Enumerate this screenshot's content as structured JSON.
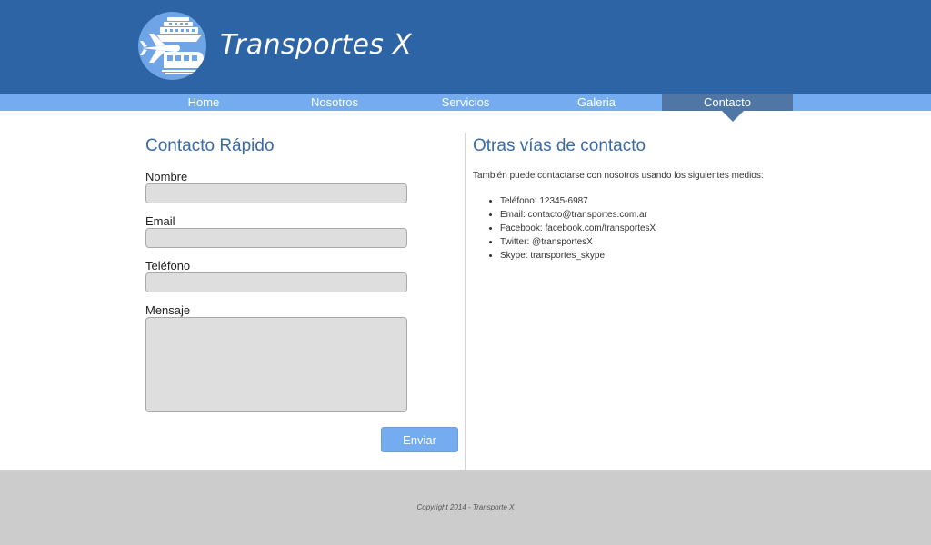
{
  "header": {
    "site_title": "Transportes X",
    "logo_icon": "plane-ship-train-logo-icon"
  },
  "nav": {
    "items": [
      {
        "label": "Home"
      },
      {
        "label": "Nosotros"
      },
      {
        "label": "Servicios"
      },
      {
        "label": "Galeria"
      },
      {
        "label": "Contacto"
      }
    ],
    "active": "Contacto"
  },
  "form": {
    "title": "Contacto Rápido",
    "fields": {
      "nombre": {
        "label": "Nombre",
        "value": "",
        "placeholder": ""
      },
      "email": {
        "label": "Email",
        "value": "",
        "placeholder": ""
      },
      "telefono": {
        "label": "Teléfono",
        "value": "",
        "placeholder": ""
      },
      "mensaje": {
        "label": "Mensaje",
        "value": "",
        "placeholder": ""
      }
    },
    "submit_label": "Enviar"
  },
  "other": {
    "title": "Otras vías de contacto",
    "intro": "También puede contactarse con nosotros usando los siguientes medios:",
    "items": [
      "Teléfono: 12345-6987",
      "Email: contacto@transportes.com.ar",
      "Facebook: facebook.com/transportesX",
      "Twitter: @transportesX",
      "Skype: transportes_skype"
    ]
  },
  "footer": {
    "copyright": "Copyright 2014 - Transporte X"
  },
  "colors": {
    "header_bg": "#2d64a5",
    "nav_bg": "#74acef",
    "nav_active_bg": "#4f76a4",
    "title_blue": "#3b6aa5",
    "footer_bg": "#cccccc"
  }
}
